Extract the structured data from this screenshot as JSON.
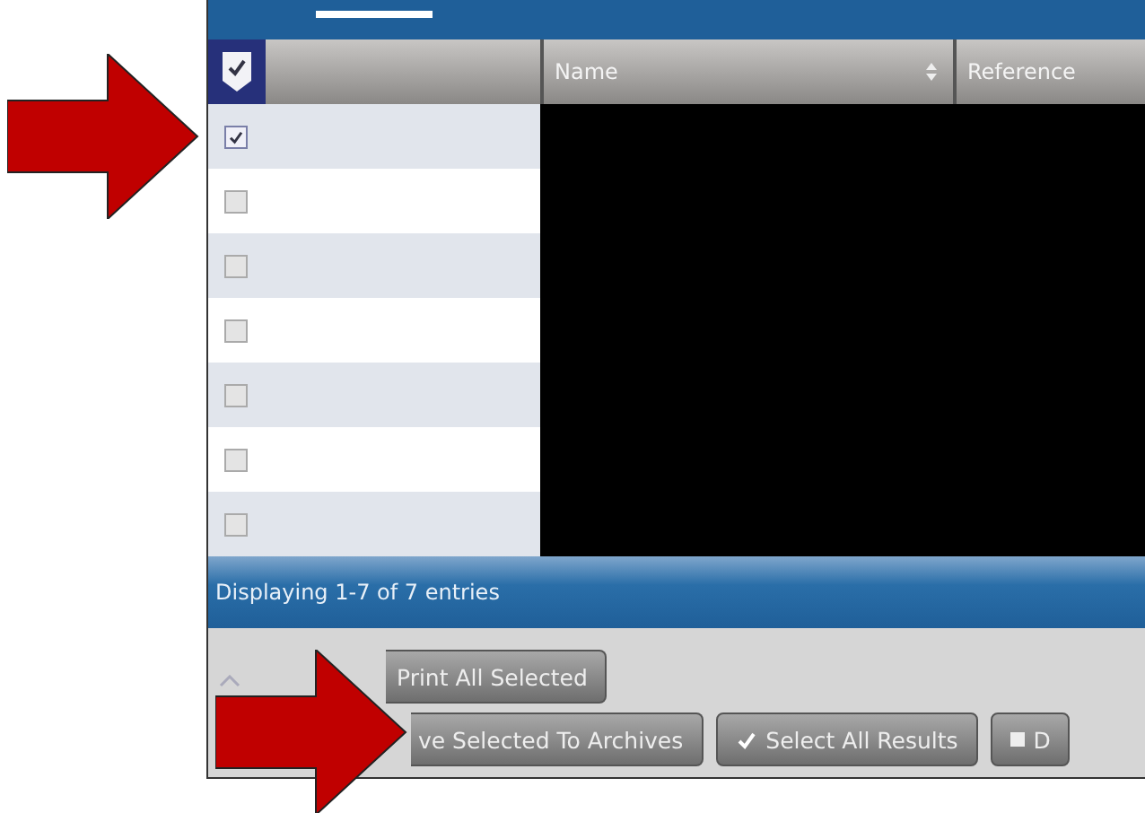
{
  "table": {
    "header_checkbox": {
      "checked": true
    },
    "columns": [
      {
        "label": "Name",
        "sortable": true
      },
      {
        "label": "Reference",
        "sortable": false
      }
    ],
    "rows": [
      {
        "checked": true
      },
      {
        "checked": false
      },
      {
        "checked": false
      },
      {
        "checked": false
      },
      {
        "checked": false
      },
      {
        "checked": false
      },
      {
        "checked": false
      }
    ]
  },
  "status_bar": {
    "text": "Displaying 1-7 of 7 entries"
  },
  "buttons": [
    [
      {
        "label": "Print All Selected"
      }
    ],
    [
      {
        "label": "ve Selected To Archives"
      },
      {
        "label": "Select All Results"
      },
      {
        "label": "D"
      }
    ]
  ],
  "annotations": [
    {
      "kind": "arrow"
    },
    {
      "kind": "arrow"
    }
  ]
}
